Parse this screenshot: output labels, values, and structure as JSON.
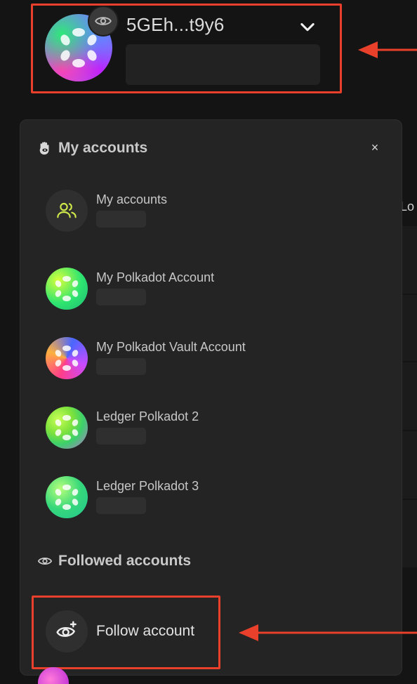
{
  "header": {
    "account_name": "5GEh...t9y6"
  },
  "panel": {
    "title": "My accounts",
    "close_label": "×",
    "accounts": [
      {
        "name": "My accounts",
        "icon": "group-icon"
      },
      {
        "name": "My Polkadot Account",
        "icon": "polkadot-avatar"
      },
      {
        "name": "My Polkadot Vault Account",
        "icon": "polkadot-avatar"
      },
      {
        "name": "Ledger Polkadot 2",
        "icon": "polkadot-avatar"
      },
      {
        "name": "Ledger Polkadot 3",
        "icon": "polkadot-avatar"
      }
    ],
    "followed_title": "Followed accounts",
    "follow_button": "Follow account"
  },
  "background": {
    "peek_text": "Lo"
  },
  "colors": {
    "highlight": "#e8402a",
    "panel_bg": "#242424",
    "page_bg": "#141414"
  }
}
